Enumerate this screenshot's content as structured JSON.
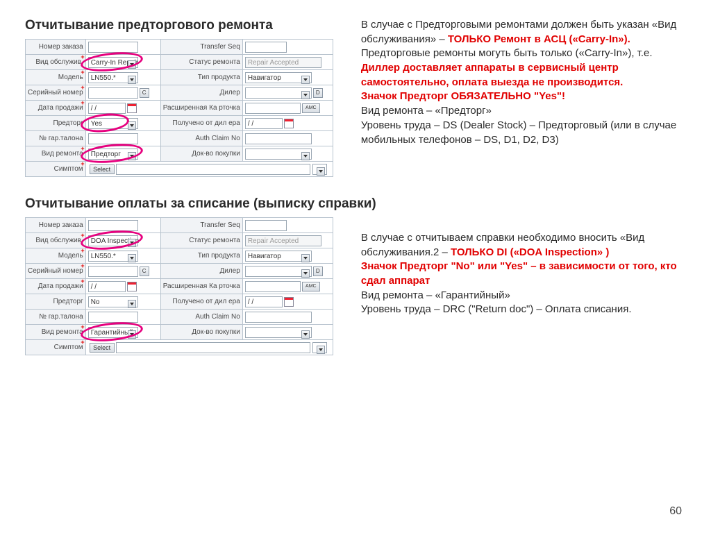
{
  "headings": {
    "h1": "Отчитывание предторгового ремонта",
    "h2": "Отчитывание оплаты за списание (выписку справки)"
  },
  "page_number": "60",
  "labels": {
    "order_no": "Номер заказа",
    "transfer_seq": "Transfer Seq",
    "service_type": "Вид обслужив.",
    "repair_status": "Статус ремонта",
    "model": "Модель",
    "prod_type": "Тип продукта",
    "serial": "Серийный номер",
    "dealer": "Дилер",
    "sale_date": "Дата продажи",
    "ext_card": "Расширенная Ка рточка",
    "pretrade": "Предторг",
    "received": "Получено от дил ера",
    "warr_card": "№ гар.талона",
    "auth_claim": "Auth Claim No",
    "repair_type": "Вид ремонта",
    "proof": "Док-во покупки",
    "symptom": "Симптом",
    "select": "Select",
    "repair_accepted": "Repair Accepted",
    "product_navigator": "Навигатор",
    "amc": "AMC",
    "slash_date": "/ /",
    "c": "C",
    "d": "D"
  },
  "form1": {
    "service_type": "Carry-In Repair",
    "model": "LN550.*",
    "pretrade": "Yes",
    "repair_type": "Предторг"
  },
  "form2": {
    "service_type": "DOA Inspection",
    "model": "LN550.*",
    "pretrade": "No",
    "repair_type": "Гарантийный"
  },
  "text1": {
    "p1": "В случае с Предторговыми ремонтами должен быть указан «Вид обслуживания» – ",
    "p1b": "ТОЛЬКО Ремонт в АСЦ («Carry-In»).",
    "p2": "Предторговые ремонты могуть быть только («Carry-In»), т.е.",
    "p3": "Диллер доставляет аппараты в сервисный центр самостоятельно, оплата выезда не производится.",
    "p4": "Значок Предторг ОБЯЗАТЕЛЬНО \"Yes\"!",
    "p5": "Вид ремонта – «Предторг»",
    "p6": "Уровень труда – DS (Dealer Stock) – Предторговый (или в случае мобильных телефонов – DS, D1, D2, D3)"
  },
  "text2": {
    "p1": "В случае с отчитываем справки необходимо вносить «Вид обслуживания.2 – ",
    "p1b": "ТОЛЬКО DI  («DOA Inspection» )",
    "p2": "Значок Предторг \"No\" или \"Yes\" – в зависимости от того, кто сдал аппарат",
    "p3": "Вид ремонта – «Гарантийный»",
    "p4": "Уровень труда – DRC (\"Return doc\") – Оплата списания."
  }
}
